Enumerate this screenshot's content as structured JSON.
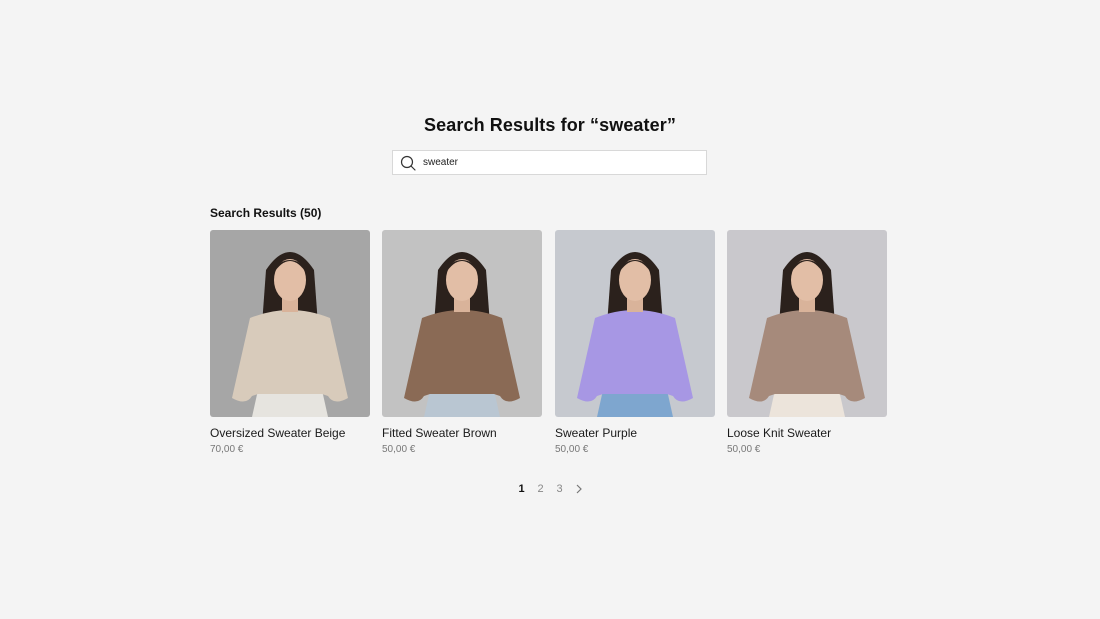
{
  "page": {
    "title": "Search Results for “sweater”"
  },
  "search": {
    "value": "sweater",
    "icon": "search-icon"
  },
  "results": {
    "header": "Search Results (50)",
    "items": [
      {
        "name": "Oversized Sweater Beige",
        "price": "70,00 €",
        "sweater_color": "#d8cbbb",
        "bg_color": "#a6a6a6",
        "pants_color": "#e6e4df"
      },
      {
        "name": "Fitted Sweater Brown",
        "price": "50,00 €",
        "sweater_color": "#8a6a55",
        "bg_color": "#c2c2c2",
        "pants_color": "#b9c6d2"
      },
      {
        "name": "Sweater Purple",
        "price": "50,00 €",
        "sweater_color": "#a797e4",
        "bg_color": "#c6c9cf",
        "pants_color": "#7ea6cf"
      },
      {
        "name": "Loose Knit Sweater",
        "price": "50,00 €",
        "sweater_color": "#a68a7b",
        "bg_color": "#c9c8cc",
        "pants_color": "#ece4db"
      }
    ]
  },
  "pagination": {
    "pages": [
      "1",
      "2",
      "3"
    ],
    "current": "1",
    "next_icon": "chevron-right-icon"
  }
}
